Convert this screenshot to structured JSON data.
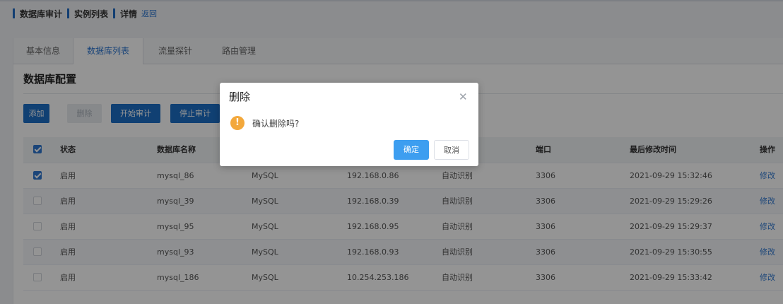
{
  "breadcrumb": {
    "items": [
      "数据库审计",
      "实例列表",
      "详情"
    ],
    "back": "返回"
  },
  "tabs": [
    {
      "label": "基本信息",
      "active": false
    },
    {
      "label": "数据库列表",
      "active": true
    },
    {
      "label": "流量探针",
      "active": false
    },
    {
      "label": "路由管理",
      "active": false
    }
  ],
  "section": {
    "title": "数据库配置"
  },
  "toolbar": {
    "add": "添加",
    "delete": "删除",
    "start_audit": "开始审计",
    "stop_audit": "停止审计"
  },
  "table": {
    "headers": {
      "status": "状态",
      "name": "数据库名称",
      "port": "端口",
      "modified": "最后修改时间",
      "action": "操作"
    },
    "rows": [
      {
        "checked": true,
        "status": "启用",
        "name": "mysql_86",
        "type": "MySQL",
        "ip": "192.168.0.86",
        "charset": "自动识别",
        "port": "3306",
        "modified": "2021-09-29 15:32:46",
        "action": "修改"
      },
      {
        "checked": false,
        "status": "启用",
        "name": "mysql_39",
        "type": "MySQL",
        "ip": "192.168.0.39",
        "charset": "自动识别",
        "port": "3306",
        "modified": "2021-09-29 15:29:26",
        "action": "修改"
      },
      {
        "checked": false,
        "status": "启用",
        "name": "mysql_95",
        "type": "MySQL",
        "ip": "192.168.0.95",
        "charset": "自动识别",
        "port": "3306",
        "modified": "2021-09-29 15:29:37",
        "action": "修改"
      },
      {
        "checked": false,
        "status": "启用",
        "name": "mysql_93",
        "type": "MySQL",
        "ip": "192.168.0.93",
        "charset": "自动识别",
        "port": "3306",
        "modified": "2021-09-29 15:30:55",
        "action": "修改"
      },
      {
        "checked": false,
        "status": "启用",
        "name": "mysql_186",
        "type": "MySQL",
        "ip": "10.254.253.186",
        "charset": "自动识别",
        "port": "3306",
        "modified": "2021-09-29 15:33:42",
        "action": "修改"
      }
    ]
  },
  "dialog": {
    "title": "删除",
    "icon": "warning-icon",
    "message": "确认删除吗?",
    "ok": "确定",
    "cancel": "取消"
  },
  "colors": {
    "primary": "#1d6fc7",
    "link": "#2f78d1",
    "warning": "#f3a83b",
    "dialog_ok": "#3d9ef0"
  }
}
